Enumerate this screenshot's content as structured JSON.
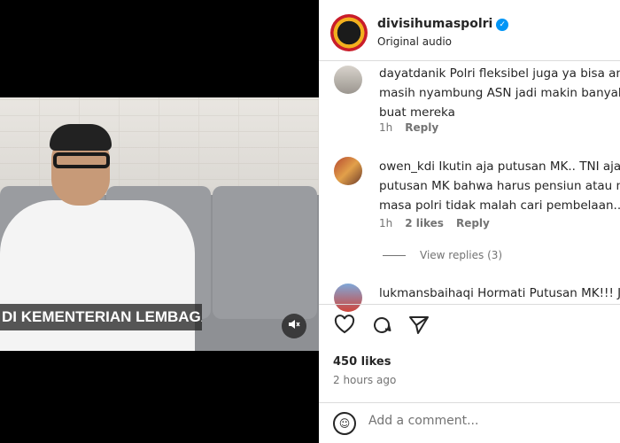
{
  "video": {
    "caption": "DI KEMENTERIAN LEMBAGA",
    "mute_icon": "speaker-muted-icon"
  },
  "post": {
    "username": "divisihumaspolri",
    "verified_icon": "verified-badge-icon",
    "subtitle": "Original audio"
  },
  "comments": [
    {
      "username": "dayatdanik",
      "lines": [
        "dayatdanik Polri fleksibel juga ya bisa amb",
        "masih nyambung ASN jadi makin banyak p",
        "buat mereka"
      ],
      "time": "1h",
      "likes": "",
      "reply_label": "Reply"
    },
    {
      "username": "owen_kdi",
      "lines": [
        "owen_kdi Ikutin aja putusan MK.. TNI aja b",
        "putusan MK bahwa harus pensiun atau me",
        "masa polri tidak malah cari pembelaan.."
      ],
      "time": "1h",
      "likes": "2 likes",
      "reply_label": "Reply"
    },
    {
      "username": "lukmansbaihaqi",
      "lines": [
        "lukmansbaihaqi Hormati Putusan MK!!! Jan"
      ],
      "time": "",
      "likes": "",
      "reply_label": ""
    }
  ],
  "view_replies": "View replies (3)",
  "actions": {
    "like_icon": "heart-icon",
    "comment_icon": "comment-icon",
    "share_icon": "share-icon"
  },
  "likes_count": "450 likes",
  "posted_time": "2 hours ago",
  "add_comment": {
    "placeholder": "Add a comment...",
    "emoji_icon": "emoji-icon"
  },
  "colors": {
    "verified": "#0095f6",
    "text": "#262626",
    "secondary": "#737373"
  }
}
